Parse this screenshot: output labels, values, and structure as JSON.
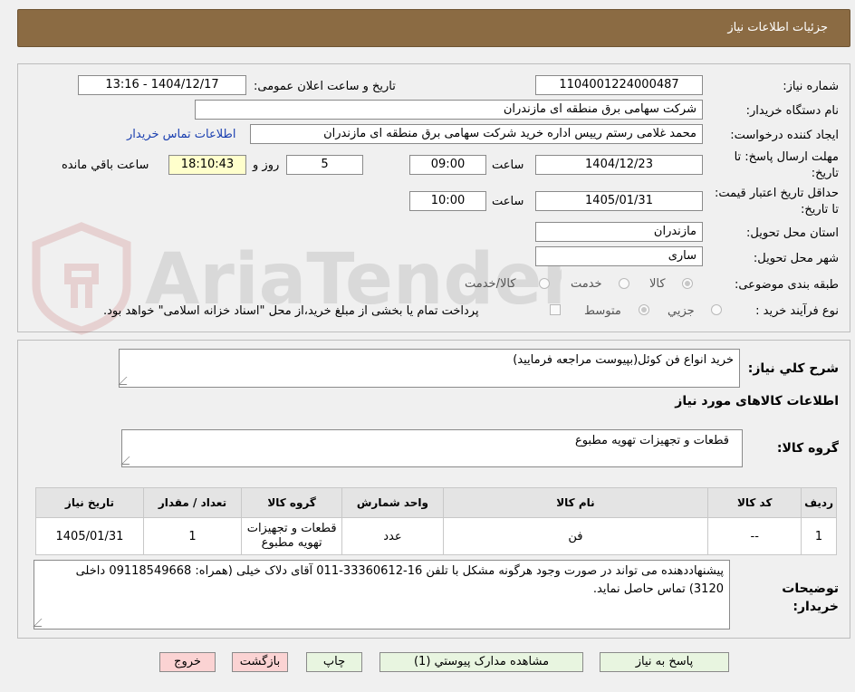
{
  "header": {
    "title": "جزئیات اطلاعات نیاز"
  },
  "form": {
    "need_number_label": "شماره نیاز:",
    "need_number": "1104001224000487",
    "announce_label": "تاریخ و ساعت اعلان عمومی:",
    "announce_value": "1404/12/17 - 13:16",
    "buyer_label": "نام دستگاه خریدار:",
    "buyer_value": "شرکت سهامی برق منطقه ای مازندران",
    "requester_label": "ایجاد کننده درخواست:",
    "requester_value": "محمد غلامی رستم رییس اداره خرید شرکت سهامی برق منطقه ای مازندران",
    "contact_link": "اطلاعات تماس خریدار",
    "deadline_label": "مهلت ارسال پاسخ: تا تاریخ:",
    "deadline_date": "1404/12/23",
    "time_label": "ساعت",
    "deadline_time": "09:00",
    "days_value": "5",
    "days_label": "روز و",
    "remaining_time": "18:10:43",
    "remaining_label": "ساعت باقي مانده",
    "validity_label": "حداقل تاریخ اعتبار قیمت: تا تاریخ:",
    "validity_date": "1405/01/31",
    "validity_time_label": "ساعت",
    "validity_time": "10:00",
    "province_label": "استان محل تحویل:",
    "province_value": "مازندران",
    "city_label": "شهر محل تحویل:",
    "city_value": "ساری",
    "category_label": "طبقه بندی موضوعی:",
    "category_options": [
      "کالا",
      "خدمت",
      "کالا/خدمت"
    ],
    "process_label": "نوع فرآیند خرید :",
    "process_options": [
      "جزیي",
      "متوسط"
    ],
    "payment_note": "پرداخت تمام یا بخشی از مبلغ خرید،از محل \"اسناد خزانه اسلامی\" خواهد بود."
  },
  "details": {
    "summary_label": "شرح کلي نياز:",
    "summary_value": "خرید انواع فن کوئل(بپیوست مراجعه فرمایید)",
    "goods_info_title": "اطلاعات کالاهای مورد نیاز",
    "goods_group_label": "گروه کالا:",
    "goods_group_value": "قطعات و تجهیزات تهویه مطبوع",
    "table": {
      "headers": [
        "رديف",
        "کد کالا",
        "نام کالا",
        "واحد شمارش",
        "گروه کالا",
        "تعداد / مقدار",
        "تاریخ نیاز"
      ],
      "rows": [
        [
          "1",
          "--",
          "فن",
          "عدد",
          "قطعات و تجهیزات تهویه مطبوع",
          "1",
          "1405/01/31"
        ]
      ]
    },
    "buyer_notes_label": "توضیحات خریدار:",
    "buyer_notes_value": "پیشنهاددهنده می تواند در صورت وجود هرگونه مشکل با تلفن 16-33360612-011 آقای دلاک خیلی  (همراه: 09118549668 داخلی 3120) تماس حاصل نماید."
  },
  "buttons": {
    "reply": "پاسخ به نیاز",
    "attachments": "مشاهده مدارک پیوستي (1)",
    "print": "چاپ",
    "back": "بازگشت",
    "exit": "خروج"
  },
  "watermark": {
    "text": "AriaTender.neT"
  },
  "colors": {
    "header": "#8b6b43",
    "link": "#1a3fb0",
    "button_green": "#e8f5e0",
    "button_pink": "#fbd3d3"
  }
}
